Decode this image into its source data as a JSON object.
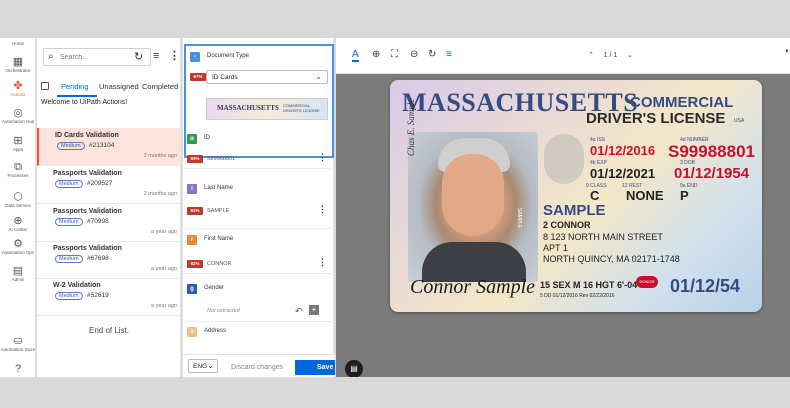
{
  "rail": {
    "home_label": "Home",
    "items": [
      {
        "label": "Orchestrator",
        "icon": "▦"
      },
      {
        "label": "Actions",
        "icon": "✤"
      },
      {
        "label": "Automation Hub",
        "icon": "◎"
      },
      {
        "label": "Apps",
        "icon": "⊞"
      },
      {
        "label": "Processes",
        "icon": "⧉"
      },
      {
        "label": "Data Service",
        "icon": "⬡"
      },
      {
        "label": "AI Center",
        "icon": "⊕"
      },
      {
        "label": "Automation Ops",
        "icon": "⚙"
      },
      {
        "label": "Admin",
        "icon": "▤"
      },
      {
        "label": "Automation Store",
        "icon": "⛀"
      },
      {
        "label": "",
        "icon": "?"
      }
    ]
  },
  "tasks": {
    "search_placeholder": "Search...",
    "tabs": [
      "Pending",
      "Unassigned",
      "Completed"
    ],
    "welcome": "Welcome to UiPath Actions!",
    "items": [
      {
        "title": "ID Cards Validation",
        "badge": "Medium",
        "id": "#213104",
        "time": "2 months ago"
      },
      {
        "title": "Passports Validation",
        "badge": "Medium",
        "id": "#209527",
        "time": "2 months ago"
      },
      {
        "title": "Passports Validation",
        "badge": "Medium",
        "id": "#70998",
        "time": "a year ago"
      },
      {
        "title": "Passports Validation",
        "badge": "Medium",
        "id": "#67698",
        "time": "a year ago"
      },
      {
        "title": "W-2 Validation",
        "badge": "Medium",
        "id": "#52619",
        "time": "a year ago"
      }
    ],
    "end_of_list": "End of List."
  },
  "fields": {
    "document_type": {
      "label": "Document Type",
      "conf": "67%",
      "value": "ID Cards",
      "thumb_title": "MASSACHUSETTS",
      "thumb_sub": "COMMERCIAL DRIVER'S LICENSE"
    },
    "id": {
      "label": "ID",
      "conf": "93%",
      "value": "S99988801"
    },
    "last_name": {
      "label": "Last Name",
      "conf": "91%",
      "value": "SAMPLE"
    },
    "first_name": {
      "label": "First Name",
      "conf": "92%",
      "value": "CONNOR"
    },
    "gender": {
      "label": "Gender",
      "value": "Not extracted"
    },
    "address": {
      "label": "Address"
    },
    "footer": {
      "lang": "ENG",
      "discard": "Discard changes",
      "save": "Save"
    }
  },
  "viewer": {
    "page_current": "1",
    "page_total": "1",
    "page_sep": "/"
  },
  "license": {
    "state": "MASSACHUSETTS",
    "type1": "COMMERCIAL",
    "type2": "DRIVER'S LICENSE",
    "usa": "USA",
    "iss_label": "4a ISS",
    "iss": "01/12/2016",
    "number_label": "4d NUMBER",
    "number": "S99988801",
    "exp_label": "4b EXP",
    "exp": "01/12/2021",
    "dob_label": "3 DOB",
    "dob": "01/12/1954",
    "class_label": "9 CLASS",
    "class": "C",
    "rest_label": "12 REST",
    "rest": "NONE",
    "end_label": "9a END",
    "end": "P",
    "last": "SAMPLE",
    "first": "2 CONNOR",
    "addr1": "8 123 NORTH MAIN STREET",
    "addr2": "APT 1",
    "addr3": "NORTH QUINCY, MA 02171-1748",
    "signature": "Connor Sample",
    "photo_signature": "Chas E. Sample",
    "side_text": "SAMPLE",
    "sex_hgt": "15 SEX M   16 HGT 6'-04\"",
    "dd": "5 DD 01/12/2016 Rev 02/22/2016",
    "heart": "DONOR",
    "date2": "01/12/54"
  },
  "colors": {
    "accent": "#0067df",
    "brand": "#e8542f",
    "select": "#fce3db"
  }
}
